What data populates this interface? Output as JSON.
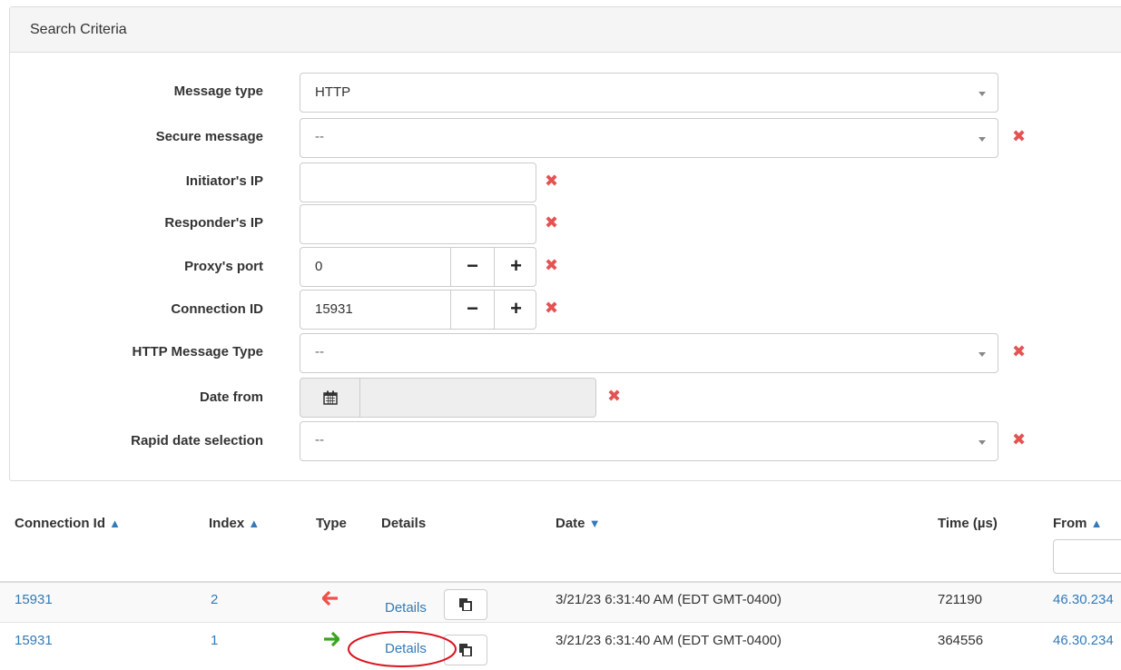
{
  "panel": {
    "title": "Search Criteria"
  },
  "form": {
    "message_type": {
      "label": "Message type",
      "value": "HTTP"
    },
    "secure_message": {
      "label": "Secure message",
      "value": "--"
    },
    "initiator_ip": {
      "label": "Initiator's IP",
      "value": ""
    },
    "responder_ip": {
      "label": "Responder's IP",
      "value": ""
    },
    "proxy_port": {
      "label": "Proxy's port",
      "value": "0"
    },
    "connection_id": {
      "label": "Connection ID",
      "value": "15931"
    },
    "http_message_type": {
      "label": "HTTP Message Type",
      "value": "--"
    },
    "date_from": {
      "label": "Date from",
      "value": ""
    },
    "rapid_date": {
      "label": "Rapid date selection",
      "value": "--"
    },
    "stepper_minus": "−",
    "stepper_plus": "+",
    "clear_glyph": "✖"
  },
  "table": {
    "headers": {
      "connection_id": "Connection Id",
      "index": "Index",
      "type": "Type",
      "details": "Details",
      "date": "Date",
      "time": "Time (µs)",
      "from": "From"
    },
    "rows": [
      {
        "connection_id": "15931",
        "index": "2",
        "type": "arrow-left-icon",
        "details": "Details",
        "date": "3/21/23 6:31:40 AM (EDT GMT-0400)",
        "time": "721190",
        "from": "46.30.234"
      },
      {
        "connection_id": "15931",
        "index": "1",
        "type": "arrow-right-icon",
        "details": "Details",
        "date": "3/21/23 6:31:40 AM (EDT GMT-0400)",
        "time": "364556",
        "from": "46.30.234"
      }
    ]
  },
  "colors": {
    "link": "#337ab7",
    "clear_icon": "#e45353",
    "arrow_in": "#f0504a",
    "arrow_out": "#3aa61e",
    "highlight_ellipse": "#d9141f"
  }
}
